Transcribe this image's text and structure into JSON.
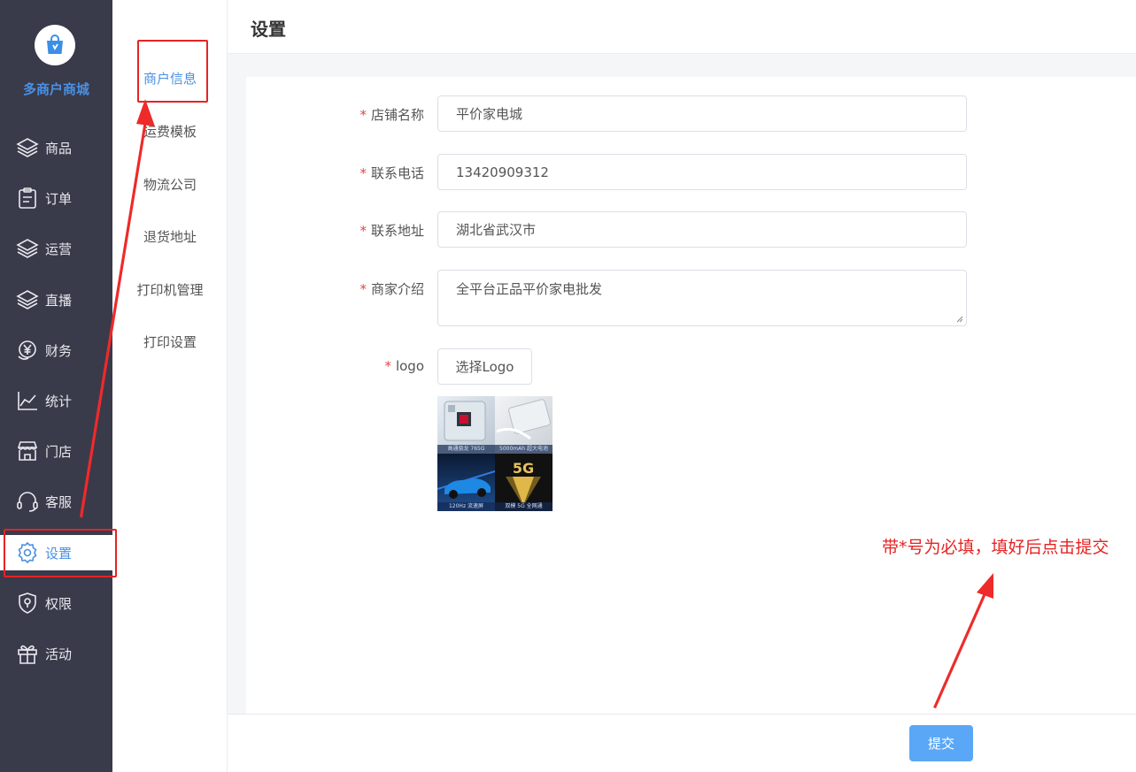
{
  "sidebar": {
    "brand": "多商户商城",
    "items": [
      {
        "label": "商品",
        "icon": "layers-icon"
      },
      {
        "label": "订单",
        "icon": "clipboard-icon"
      },
      {
        "label": "运营",
        "icon": "layers-icon"
      },
      {
        "label": "直播",
        "icon": "layers-icon"
      },
      {
        "label": "财务",
        "icon": "yen-coin-icon"
      },
      {
        "label": "统计",
        "icon": "line-chart-icon"
      },
      {
        "label": "门店",
        "icon": "store-icon"
      },
      {
        "label": "客服",
        "icon": "headset-icon"
      },
      {
        "label": "设置",
        "icon": "gear-icon",
        "active": true
      },
      {
        "label": "权限",
        "icon": "shield-icon"
      },
      {
        "label": "活动",
        "icon": "gift-icon"
      }
    ]
  },
  "submenu": {
    "items": [
      {
        "label": "商户信息",
        "active": true
      },
      {
        "label": "运费模板"
      },
      {
        "label": "物流公司"
      },
      {
        "label": "退货地址"
      },
      {
        "label": "打印机管理"
      },
      {
        "label": "打印设置"
      }
    ]
  },
  "header": {
    "title": "设置"
  },
  "form": {
    "required_mark": "*",
    "shop_name": {
      "label": "店铺名称",
      "value": "平价家电城"
    },
    "phone": {
      "label": "联系电话",
      "value": "13420909312"
    },
    "address": {
      "label": "联系地址",
      "value": "湖北省武汉市"
    },
    "intro": {
      "label": "商家介绍",
      "value": "全平台正品平价家电批发"
    },
    "logo": {
      "label": "logo",
      "choose_button": "选择Logo",
      "tiles": [
        "高通骁龙 765G",
        "5000mAh 超大电池",
        "120Hz 流速屏",
        "双模 5G 全网通"
      ],
      "tile_badge": "5G"
    }
  },
  "footer": {
    "submit_label": "提交"
  },
  "annotation": {
    "note": "带*号为必填，填好后点击提交",
    "color": "#e52323"
  },
  "colors": {
    "sidebar_bg": "#393a4a",
    "accent": "#4a90e2",
    "submit_bg": "#5aa7f7",
    "required": "#e54545"
  }
}
